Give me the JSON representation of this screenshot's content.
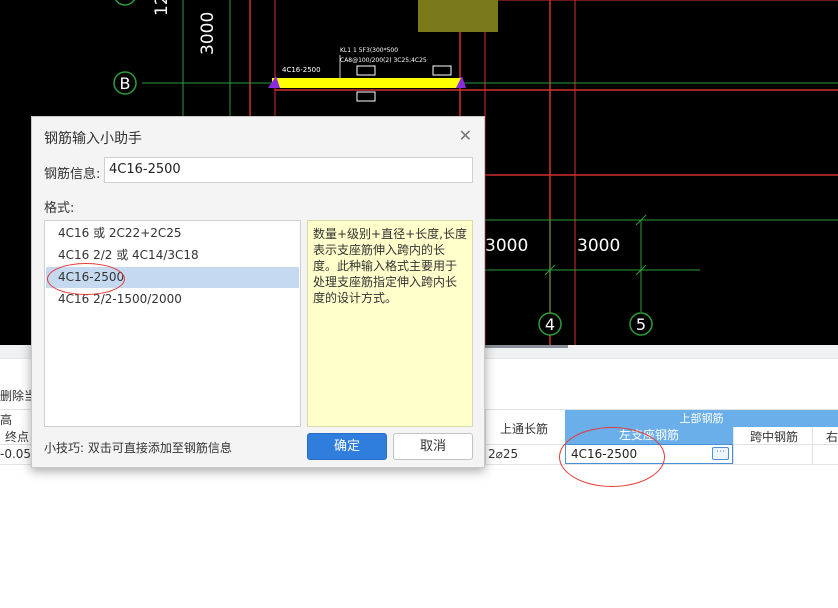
{
  "cad": {
    "axis_b": "B",
    "axis_4": "4",
    "axis_5": "5",
    "dim_3000_vertical": "3000",
    "dim_120": "12",
    "dim_3000_a": "3000",
    "dim_3000_b": "3000",
    "beam_label": "4C16-2500",
    "beam_note_1": "KL1 1 5F3(300*500",
    "beam_note_2": "CA8@100/200(2) 3C25;4C25"
  },
  "grid": {
    "delete_current": "删除当前",
    "col_height": "高",
    "col_end": "终点",
    "row_value": "-0.05",
    "col_top_through": "上通长筋",
    "top_through_value": "2⌀25",
    "group_top": "上部钢筋",
    "col_left_support": "左支座钢筋",
    "col_mid": "跨中钢筋",
    "col_right": "右",
    "left_support_value": "4C16-2500",
    "more_icon": "⋯"
  },
  "dialog": {
    "title": "钢筋输入小助手",
    "close_icon": "✕",
    "info_label": "钢筋信息:",
    "info_value": "4C16-2500",
    "format_label": "格式:",
    "formats": [
      "4C16 或 2C22+2C25",
      "4C16 2/2 或 4C14/3C18",
      "4C16-2500",
      "4C16 2/2-1500/2000"
    ],
    "description": "数量+级别+直径+长度,长度表示支座筋伸入跨内的长度。此种输入格式主要用于处理支座筋指定伸入跨内长度的设计方式。",
    "tip": "小技巧: 双击可直接添加至钢筋信息",
    "ok_label": "确定",
    "cancel_label": "取消"
  }
}
